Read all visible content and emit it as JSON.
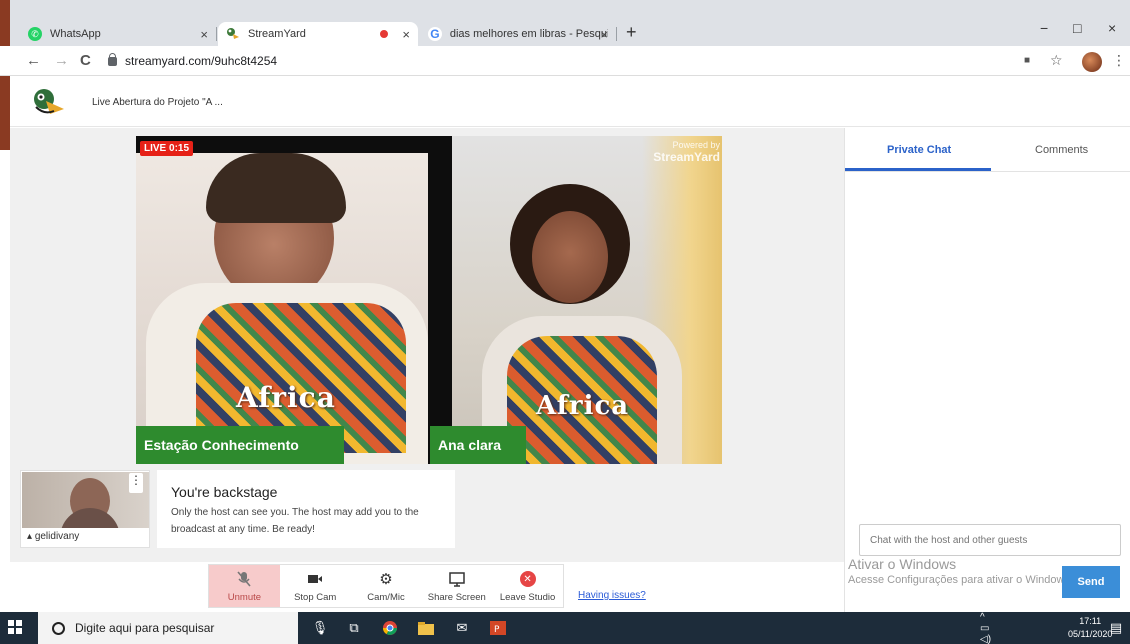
{
  "browser": {
    "tabs": [
      {
        "title": "WhatsApp",
        "close": "×"
      },
      {
        "title": "StreamYard",
        "close": "×"
      },
      {
        "title": "dias melhores em libras - Pesqui",
        "close": "×"
      }
    ],
    "new_tab": "+",
    "window_controls": {
      "minimize": "−",
      "maximize": "□",
      "close": "×"
    },
    "url": "streamyard.com/9uhc8t4254",
    "nav": {
      "back": "←",
      "forward": "→",
      "reload": "C"
    },
    "right_icons": {
      "camera": "■",
      "star": "☆",
      "menu": "⋮"
    }
  },
  "streamyard": {
    "broadcast_title": "Live Abertura do Projeto \"A ...",
    "live_badge": "LIVE 0:15",
    "watermark_small": "Powered by",
    "watermark_brand": "StreamYard",
    "participants": [
      {
        "name": "Estação Conhecimento",
        "shirt_text": "Africa"
      },
      {
        "name": "Ana clara",
        "shirt_text": "Africa"
      }
    ],
    "self": {
      "username": "gelidivany",
      "menu": "⋮"
    },
    "backstage": {
      "title": "You're backstage",
      "message": "Only the host can see you. The host may add you to the broadcast at any time. Be ready!"
    },
    "controls": [
      {
        "label": "Unmute",
        "icon": "mic-off-icon"
      },
      {
        "label": "Stop Cam",
        "icon": "camera-icon"
      },
      {
        "label": "Cam/Mic",
        "icon": "gear-icon"
      },
      {
        "label": "Share Screen",
        "icon": "monitor-icon"
      },
      {
        "label": "Leave Studio",
        "icon": "leave-icon"
      }
    ],
    "having_issues": "Having issues?",
    "chat": {
      "tabs": [
        "Private Chat",
        "Comments"
      ],
      "input_placeholder": "Chat with the host and other guests",
      "send_label": "Send"
    },
    "colors": {
      "accent": "#2b62c9",
      "name_tag": "#2e8b2e",
      "live": "#e62117",
      "send": "#3b8ed8"
    }
  },
  "windows": {
    "activation_line1": "Ativar o Windows",
    "activation_line2": "Acesse Configurações para ativar o Windows.",
    "taskbar_search": "Digite aqui para pesquisar",
    "time": "17:11",
    "date": "05/11/2020"
  }
}
